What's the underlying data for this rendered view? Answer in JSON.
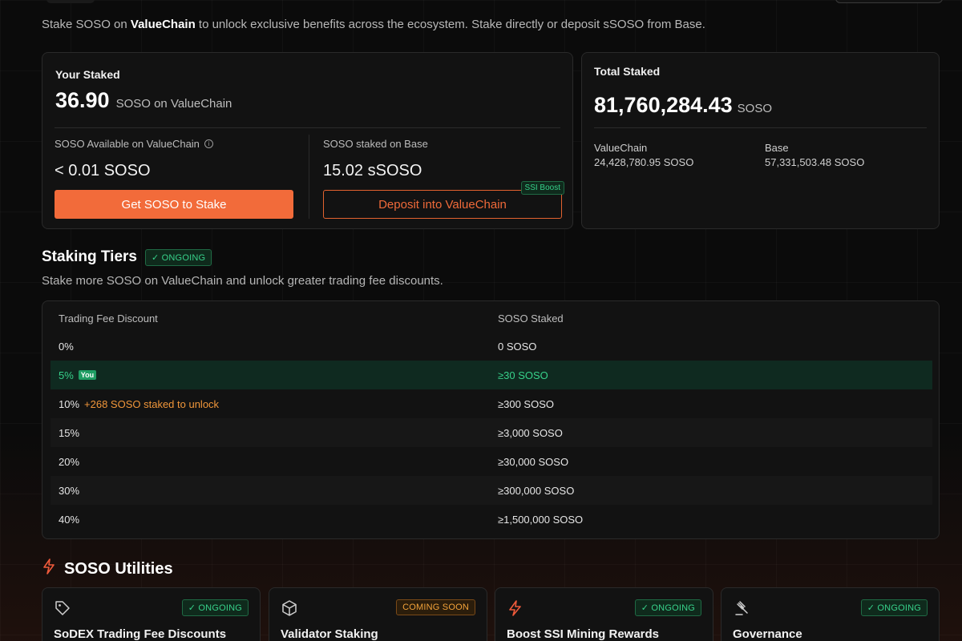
{
  "intro": {
    "prefix": "Stake SOSO on ",
    "chain": "ValueChain",
    "suffix": " to unlock exclusive benefits across the ecosystem. Stake directly or deposit sSOSO from Base."
  },
  "your_staked": {
    "title": "Your Staked",
    "amount": "36.90",
    "unit": "SOSO on ValueChain",
    "available_label": "SOSO Available on ValueChain",
    "available_value": "< 0.01 SOSO",
    "base_label": "SOSO staked on Base",
    "base_value": "15.02 sSOSO",
    "get_button": "Get SOSO to Stake",
    "deposit_button": "Deposit into ValueChain",
    "ssi_badge": "SSI Boost"
  },
  "total_staked": {
    "title": "Total Staked",
    "amount": "81,760,284.43",
    "unit": "SOSO",
    "valuechain_label": "ValueChain",
    "valuechain_value": "24,428,780.95 SOSO",
    "base_label": "Base",
    "base_value": "57,331,503.48 SOSO"
  },
  "tiers": {
    "title": "Staking Tiers",
    "status": "✓ ONGOING",
    "subtitle": "Stake more SOSO on ValueChain and unlock greater trading fee discounts.",
    "col_discount": "Trading Fee Discount",
    "col_staked": "SOSO Staked",
    "rows": [
      {
        "discount": "0%",
        "staked": "0 SOSO",
        "note": "",
        "badge": ""
      },
      {
        "discount": "5%",
        "staked": "≥30 SOSO",
        "note": "",
        "badge": "You"
      },
      {
        "discount": "10%",
        "staked": "≥300 SOSO",
        "note": "+268 SOSO staked to unlock",
        "badge": ""
      },
      {
        "discount": "15%",
        "staked": "≥3,000 SOSO",
        "note": "",
        "badge": ""
      },
      {
        "discount": "20%",
        "staked": "≥30,000 SOSO",
        "note": "",
        "badge": ""
      },
      {
        "discount": "30%",
        "staked": "≥300,000 SOSO",
        "note": "",
        "badge": ""
      },
      {
        "discount": "40%",
        "staked": "≥1,500,000 SOSO",
        "note": "",
        "badge": ""
      }
    ]
  },
  "utilities": {
    "title": "SOSO Utilities",
    "cards": [
      {
        "name": "SoDEX Trading Fee Discounts",
        "status": "✓ ONGOING",
        "icon": "tag-icon"
      },
      {
        "name": "Validator Staking",
        "status": "COMING SOON",
        "icon": "cube-icon"
      },
      {
        "name": "Boost SSI Mining Rewards",
        "status": "✓ ONGOING",
        "icon": "bolt-icon"
      },
      {
        "name": "Governance",
        "status": "✓ ONGOING",
        "icon": "gavel-icon"
      }
    ]
  },
  "colors": {
    "accent": "#f26b3a",
    "positive": "#37d18a",
    "warning": "#f0963a"
  }
}
